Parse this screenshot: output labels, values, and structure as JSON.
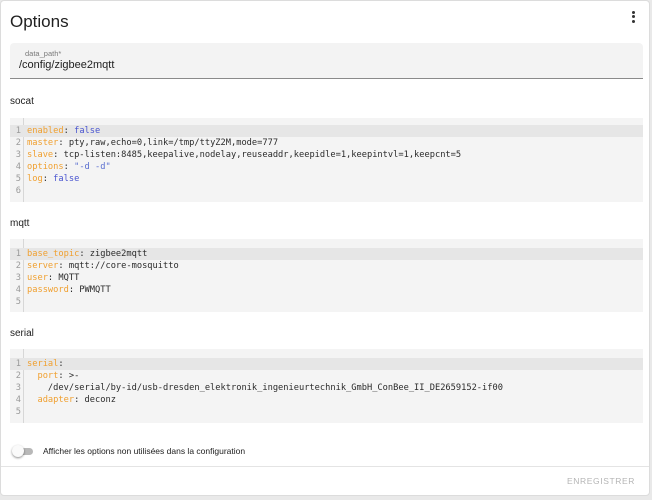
{
  "header": {
    "title": "Options"
  },
  "data_path": {
    "label": "data_path*",
    "value": "/config/zigbee2mqtt"
  },
  "sections": {
    "socat": {
      "label": "socat",
      "lines": [
        {
          "n": "1",
          "tokens": [
            {
              "t": "enabled",
              "c": "kw"
            },
            {
              "t": ": ",
              "c": "p"
            },
            {
              "t": "false",
              "c": "b"
            }
          ]
        },
        {
          "n": "2",
          "tokens": [
            {
              "t": "master",
              "c": "kw"
            },
            {
              "t": ": pty,raw,echo=0,link=/tmp/ttyZ2M,mode=777",
              "c": "p"
            }
          ]
        },
        {
          "n": "3",
          "tokens": [
            {
              "t": "slave",
              "c": "kw"
            },
            {
              "t": ": tcp-listen:8485,keepalive,nodelay,reuseaddr,keepidle=1,keepintvl=1,keepcnt=5",
              "c": "p"
            }
          ]
        },
        {
          "n": "4",
          "tokens": [
            {
              "t": "options",
              "c": "kw"
            },
            {
              "t": ": ",
              "c": "p"
            },
            {
              "t": "\"-d -d\"",
              "c": "s"
            }
          ]
        },
        {
          "n": "5",
          "tokens": [
            {
              "t": "log",
              "c": "kw"
            },
            {
              "t": ": ",
              "c": "p"
            },
            {
              "t": "false",
              "c": "b"
            }
          ]
        },
        {
          "n": "6",
          "tokens": []
        }
      ]
    },
    "mqtt": {
      "label": "mqtt",
      "lines": [
        {
          "n": "1",
          "tokens": [
            {
              "t": "base_topic",
              "c": "kw"
            },
            {
              "t": ": zigbee2mqtt",
              "c": "p"
            }
          ]
        },
        {
          "n": "2",
          "tokens": [
            {
              "t": "server",
              "c": "kw"
            },
            {
              "t": ": mqtt://core-mosquitto",
              "c": "p"
            }
          ]
        },
        {
          "n": "3",
          "tokens": [
            {
              "t": "user",
              "c": "kw"
            },
            {
              "t": ": MQTT",
              "c": "p"
            }
          ]
        },
        {
          "n": "4",
          "tokens": [
            {
              "t": "password",
              "c": "kw"
            },
            {
              "t": ": PWMQTT",
              "c": "p"
            }
          ]
        },
        {
          "n": "5",
          "tokens": []
        }
      ]
    },
    "serial": {
      "label": "serial",
      "lines": [
        {
          "n": "1",
          "tokens": [
            {
              "t": "serial",
              "c": "kw"
            },
            {
              "t": ":",
              "c": "p"
            }
          ]
        },
        {
          "n": "2",
          "tokens": [
            {
              "t": "  port",
              "c": "kw"
            },
            {
              "t": ": >-",
              "c": "p"
            }
          ]
        },
        {
          "n": "3",
          "tokens": [
            {
              "t": "    /dev/serial/by-id/usb-dresden_elektronik_ingenieurtechnik_GmbH_ConBee_II_DE2659152-if00",
              "c": "p"
            }
          ]
        },
        {
          "n": "4",
          "tokens": [
            {
              "t": "  adapter",
              "c": "kw"
            },
            {
              "t": ": deconz",
              "c": "p"
            }
          ]
        },
        {
          "n": "5",
          "tokens": []
        }
      ]
    }
  },
  "toggle": {
    "label": "Afficher les options non utilisées dans la configuration",
    "on": false
  },
  "actions": {
    "save_label": "ENREGISTRER"
  },
  "icons": {
    "menu": "more-vertical-icon"
  },
  "colors": {
    "key": "#f0a030",
    "boolean": "#4a55d0",
    "string": "#5b6fd0",
    "disabled_button": "#b5b5b5"
  }
}
